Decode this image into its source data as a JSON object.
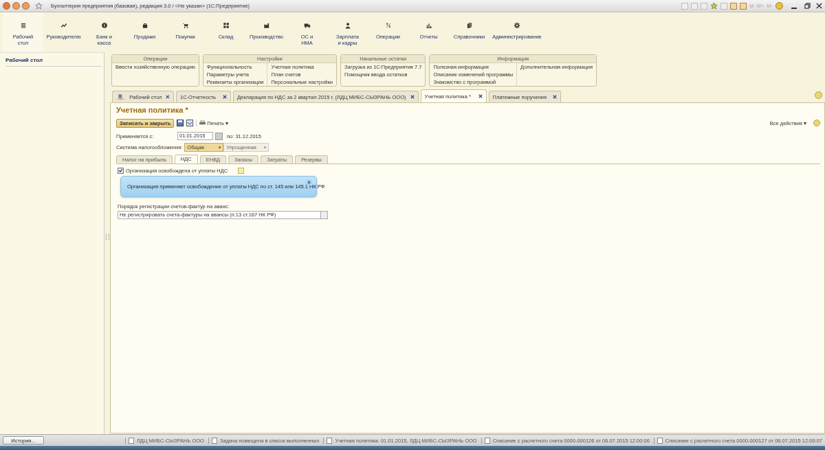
{
  "window": {
    "title": "Бухгалтерия предприятия (базовая), редакция 3.0 / <Не указан>  (1С:Предприятие)",
    "memory_buttons": [
      "M",
      "M+",
      "M-"
    ]
  },
  "sections": [
    {
      "label": "Рабочий\nстол",
      "selected": true
    },
    {
      "label": "Руководителю",
      "selected": false
    },
    {
      "label": "Банк и\nкасса",
      "selected": false
    },
    {
      "label": "Продажи",
      "selected": false
    },
    {
      "label": "Покупки",
      "selected": false
    },
    {
      "label": "Склад",
      "selected": false
    },
    {
      "label": "Производство",
      "selected": false
    },
    {
      "label": "ОС и\nНМА",
      "selected": false
    },
    {
      "label": "Зарплата\nи кадры",
      "selected": false
    },
    {
      "label": "Операции",
      "selected": false
    },
    {
      "label": "Отчеты",
      "selected": false
    },
    {
      "label": "Справочники",
      "selected": false
    },
    {
      "label": "Администрирование",
      "selected": false
    }
  ],
  "sidebar": {
    "title": "Рабочий стол"
  },
  "panel_groups": [
    {
      "title": "Операции",
      "columns": [
        [
          "Ввести хозяйственную операцию"
        ]
      ]
    },
    {
      "title": "Настройки",
      "columns": [
        [
          "Функциональность",
          "Параметры учета",
          "Реквизиты организации"
        ],
        [
          "Учетная политика",
          "План счетов",
          "Персональные настройки"
        ]
      ]
    },
    {
      "title": "Начальные остатки",
      "columns": [
        [
          "Загрузка из 1С:Предприятия 7.7",
          "Помощник ввода остатков"
        ]
      ]
    },
    {
      "title": "Информация",
      "columns": [
        [
          "Полезная информация",
          "Описание изменений программы",
          "Знакомство с программой"
        ],
        [
          "Дополнительная информация"
        ]
      ]
    }
  ],
  "open_tabs": [
    {
      "label": "Рабочий стол",
      "kind": "home",
      "selected": false
    },
    {
      "label": "1С-Отчетность",
      "kind": "doc",
      "selected": false
    },
    {
      "label": "Декларация по НДС за 2 квартал 2015 г. (ЛДЦ МИБС-СЫЗРАНЬ ООО)",
      "kind": "doc",
      "selected": false
    },
    {
      "label": "Учетная политика *",
      "kind": "doc",
      "selected": true
    },
    {
      "label": "Платежные поручения",
      "kind": "doc",
      "selected": false
    }
  ],
  "form": {
    "title": "Учетная политика *",
    "save_close_button": "Записать и закрыть",
    "print_button": "Печать ▾",
    "all_actions": "Все действия ▾",
    "applies_from_label": "Применяется с:",
    "applies_from_value": "01.01.2015",
    "applies_to": "по: 31.12.2015",
    "tax_system_label": "Система налогообложения:",
    "tax_systems": [
      {
        "label": "Общая",
        "selected": true
      },
      {
        "label": "Упрощенная",
        "selected": false
      }
    ],
    "tabs": [
      {
        "label": "Налог на прибыль",
        "selected": false
      },
      {
        "label": "НДС",
        "selected": true
      },
      {
        "label": "ЕНВД",
        "selected": false
      },
      {
        "label": "Запасы",
        "selected": false
      },
      {
        "label": "Затраты",
        "selected": false
      },
      {
        "label": "Резервы",
        "selected": false
      }
    ],
    "exempt": {
      "label": "Организация освобождена от уплаты НДС",
      "checked": true
    },
    "tooltip": "Организация применяет освобождение от уплаты НДС по ст. 145 или 145.1 НК РФ",
    "invoice_label": "Порядок регистрации счетов-фактур на аванс:",
    "invoice_value": "Не регистрировать счета-фактуры на авансы (п.13 ст.167 НК РФ)"
  },
  "status_bar": {
    "history_button": "История...",
    "messages": [
      "ЛДЦ МИБС-СЫЗРАНЬ ООО",
      "Задача помещена в список выполненных",
      "Учетная политика: 01.01.2015, ЛДЦ МИБС-СЫЗРАНЬ ООО",
      "Списание с расчетного счета 0000-000126 от 06.07.2015 12:00:06",
      "Списание с расчетного счета 0000-000127 от 06.07.2015 12:00:07"
    ]
  }
}
